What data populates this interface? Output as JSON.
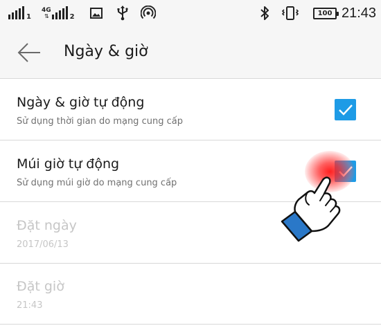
{
  "status_bar": {
    "sim1": "1",
    "sim2": "2",
    "network_type": "4G",
    "network_arrows": "⇅",
    "battery": "100",
    "time": "21:43",
    "icons": [
      "signal-icon",
      "signal-icon",
      "gallery-icon",
      "usb-icon",
      "hotspot-icon",
      "bluetooth-icon",
      "vibrate-icon",
      "battery-icon"
    ]
  },
  "app_bar": {
    "title": "Ngày & giờ",
    "back_icon": "arrow-left-icon"
  },
  "settings": [
    {
      "title": "Ngày & giờ tự động",
      "summary": "Sử dụng thời gian do mạng cung cấp",
      "checked": true,
      "enabled": true
    },
    {
      "title": "Múi giờ tự động",
      "summary": "Sử dụng múi giờ do mạng cung cấp",
      "checked": true,
      "enabled": true
    },
    {
      "title": "Đặt ngày",
      "summary": "2017/06/13",
      "enabled": false
    },
    {
      "title": "Đặt giờ",
      "summary": "21:43",
      "enabled": false
    }
  ],
  "colors": {
    "accent": "#1e9be6",
    "tap_highlight": "#ff1a1a",
    "hand_cuff": "#2a78c8"
  },
  "annotation_icons": [
    "tap-highlight",
    "pointing-hand-icon"
  ]
}
